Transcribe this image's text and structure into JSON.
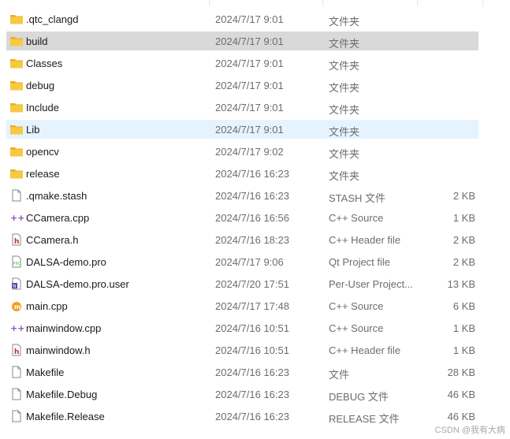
{
  "files": [
    {
      "name": ".qtc_clangd",
      "date": "2024/7/17 9:01",
      "type": "文件夹",
      "size": "",
      "icon": "folder-icon",
      "state": ""
    },
    {
      "name": "build",
      "date": "2024/7/17 9:01",
      "type": "文件夹",
      "size": "",
      "icon": "folder-icon",
      "state": "selected"
    },
    {
      "name": "Classes",
      "date": "2024/7/17 9:01",
      "type": "文件夹",
      "size": "",
      "icon": "folder-icon",
      "state": ""
    },
    {
      "name": "debug",
      "date": "2024/7/17 9:01",
      "type": "文件夹",
      "size": "",
      "icon": "folder-icon",
      "state": ""
    },
    {
      "name": "Include",
      "date": "2024/7/17 9:01",
      "type": "文件夹",
      "size": "",
      "icon": "folder-icon",
      "state": ""
    },
    {
      "name": "Lib",
      "date": "2024/7/17 9:01",
      "type": "文件夹",
      "size": "",
      "icon": "folder-icon",
      "state": "hover"
    },
    {
      "name": "opencv",
      "date": "2024/7/17 9:02",
      "type": "文件夹",
      "size": "",
      "icon": "folder-icon",
      "state": ""
    },
    {
      "name": "release",
      "date": "2024/7/16 16:23",
      "type": "文件夹",
      "size": "",
      "icon": "folder-icon",
      "state": ""
    },
    {
      "name": ".qmake.stash",
      "date": "2024/7/16 16:23",
      "type": "STASH 文件",
      "size": "2 KB",
      "icon": "file-icon",
      "state": ""
    },
    {
      "name": "CCamera.cpp",
      "date": "2024/7/16 16:56",
      "type": "C++ Source",
      "size": "1 KB",
      "icon": "cpp-source-icon",
      "state": ""
    },
    {
      "name": "CCamera.h",
      "date": "2024/7/16 18:23",
      "type": "C++ Header file",
      "size": "2 KB",
      "icon": "cpp-header-icon",
      "state": ""
    },
    {
      "name": "DALSA-demo.pro",
      "date": "2024/7/17 9:06",
      "type": "Qt Project file",
      "size": "2 KB",
      "icon": "qt-project-icon",
      "state": ""
    },
    {
      "name": "DALSA-demo.pro.user",
      "date": "2024/7/20 17:51",
      "type": "Per-User Project...",
      "size": "13 KB",
      "icon": "user-project-icon",
      "state": ""
    },
    {
      "name": "main.cpp",
      "date": "2024/7/17 17:48",
      "type": "C++ Source",
      "size": "6 KB",
      "icon": "cpp-main-icon",
      "state": ""
    },
    {
      "name": "mainwindow.cpp",
      "date": "2024/7/16 10:51",
      "type": "C++ Source",
      "size": "1 KB",
      "icon": "cpp-source-icon",
      "state": ""
    },
    {
      "name": "mainwindow.h",
      "date": "2024/7/16 10:51",
      "type": "C++ Header file",
      "size": "1 KB",
      "icon": "cpp-header-icon",
      "state": ""
    },
    {
      "name": "Makefile",
      "date": "2024/7/16 16:23",
      "type": "文件",
      "size": "28 KB",
      "icon": "file-icon",
      "state": ""
    },
    {
      "name": "Makefile.Debug",
      "date": "2024/7/16 16:23",
      "type": "DEBUG 文件",
      "size": "46 KB",
      "icon": "file-icon",
      "state": ""
    },
    {
      "name": "Makefile.Release",
      "date": "2024/7/16 16:23",
      "type": "RELEASE 文件",
      "size": "46 KB",
      "icon": "file-icon",
      "state": ""
    }
  ],
  "watermark": "CSDN @我有大病",
  "colors": {
    "folder": "#f8c93f",
    "selected": "#d9d9d9",
    "hover": "#e5f3ff",
    "cpp": "#8a4fb8",
    "header": "#b5351b"
  }
}
